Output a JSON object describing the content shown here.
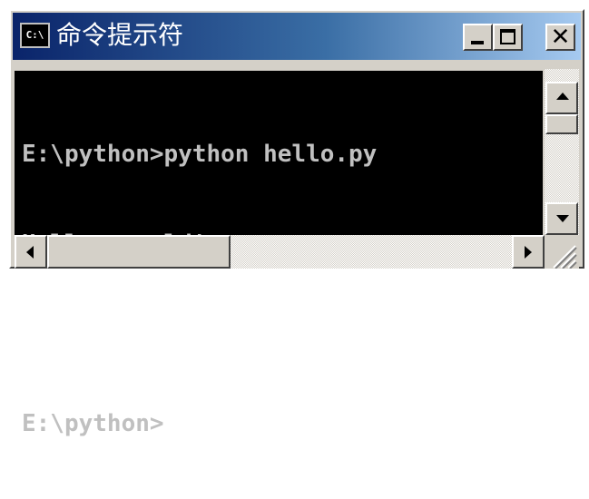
{
  "window": {
    "title": "命令提示符",
    "app_icon_label": "C:\\"
  },
  "title_buttons": {
    "minimize": "minimize",
    "maximize": "maximize",
    "close": "✕"
  },
  "console": {
    "lines": [
      "E:\\python>python hello.py",
      "Hello, world!",
      "",
      "E:\\python>"
    ],
    "colors": {
      "background": "#000000",
      "foreground": "#c0c0c0"
    }
  },
  "scrollbars": {
    "vertical_up_icon": "arrow-up-icon",
    "vertical_down_icon": "arrow-down-icon",
    "horizontal_left_icon": "arrow-left-icon",
    "horizontal_right_icon": "arrow-right-icon"
  },
  "colors": {
    "title_gradient_start": "#0a246a",
    "title_gradient_end": "#a6caf0",
    "chrome": "#d4d0c8"
  }
}
